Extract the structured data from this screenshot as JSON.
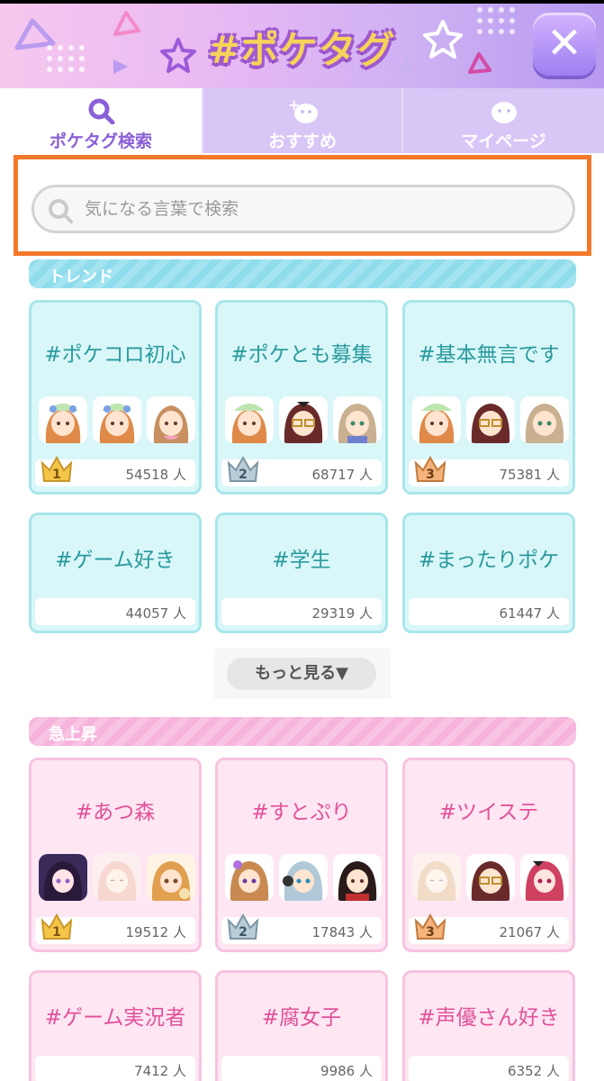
{
  "header": {
    "title": "#ポケタグ",
    "colors": {
      "title": "#f7d25a",
      "outline": "#a05ad0",
      "close_button": "#a88af0"
    }
  },
  "tabs": [
    {
      "label": "ポケタグ検索",
      "icon": "search-icon",
      "active": true
    },
    {
      "label": "おすすめ",
      "icon": "chick-plus-icon",
      "active": false
    },
    {
      "label": "マイページ",
      "icon": "chick-icon",
      "active": false
    }
  ],
  "search": {
    "placeholder": "気になる言葉で検索"
  },
  "trend": {
    "label": "トレンド",
    "cards": [
      {
        "tag": "#ポケコロ初心",
        "count": "54518 人",
        "rank": "1"
      },
      {
        "tag": "#ポケとも募集",
        "count": "68717 人",
        "rank": "2"
      },
      {
        "tag": "#基本無言です",
        "count": "75381 人",
        "rank": "3"
      },
      {
        "tag": "#ゲーム好き",
        "count": "44057 人"
      },
      {
        "tag": "#学生",
        "count": "29319 人"
      },
      {
        "tag": "#まったりポケ",
        "count": "61447 人"
      }
    ],
    "more_label": "もっと見る▼"
  },
  "rising": {
    "label": "急上昇",
    "cards": [
      {
        "tag": "#あつ森",
        "count": "19512 人",
        "rank": "1"
      },
      {
        "tag": "#すとぷり",
        "count": "17843 人",
        "rank": "2"
      },
      {
        "tag": "#ツイステ",
        "count": "21067 人",
        "rank": "3"
      },
      {
        "tag": "#ゲーム実況者",
        "count": "7412 人"
      },
      {
        "tag": "#腐女子",
        "count": "9986 人"
      },
      {
        "tag": "#声優さん好き",
        "count": "6352 人"
      }
    ]
  }
}
